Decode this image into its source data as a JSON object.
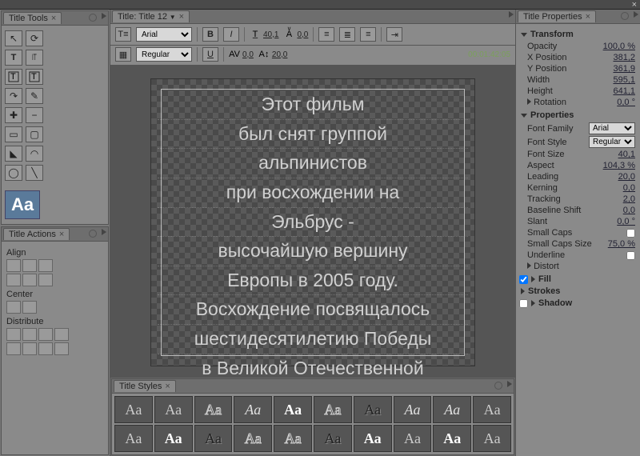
{
  "panels": {
    "tools": "Title Tools",
    "actions": "Title Actions",
    "titler": "Title: Title 12",
    "styles": "Title Styles",
    "properties": "Title Properties"
  },
  "toolbar": {
    "font": "Arial",
    "fontStyle": "Regular",
    "fontSize": "40,1",
    "leading": "20,0",
    "kerning": "0,0",
    "timecode": "00:01:42:05"
  },
  "titleText": {
    "l1": "Этот фильм",
    "l2": "был снят группой",
    "l3": "альпинистов",
    "l4": "при восхождении на",
    "l5": "Эльбрус -",
    "l6": "высочайшую вершину",
    "l7": "Европы в 2005 году.",
    "l8": "Восхождение посвящалось",
    "l9": "шестидесятилетию Победы",
    "l10": "в Великой Отечественной"
  },
  "actions": {
    "align": "Align",
    "center": "Center",
    "distribute": "Distribute"
  },
  "props": {
    "transform": "Transform",
    "opacity_l": "Opacity",
    "opacity_v": "100,0 %",
    "xpos_l": "X Position",
    "xpos_v": "381,2",
    "ypos_l": "Y Position",
    "ypos_v": "361,9",
    "width_l": "Width",
    "width_v": "595,1",
    "height_l": "Height",
    "height_v": "641,1",
    "rotation_l": "Rotation",
    "rotation_v": "0,0 °",
    "properties": "Properties",
    "fontfam_l": "Font Family",
    "fontfam_v": "Arial",
    "fontstyle_l": "Font Style",
    "fontstyle_v": "Regular",
    "fontsize_l": "Font Size",
    "fontsize_v": "40,1",
    "aspect_l": "Aspect",
    "aspect_v": "104,3 %",
    "leading_l": "Leading",
    "leading_v": "20,0",
    "kerning_l": "Kerning",
    "kerning_v": "0,0",
    "tracking_l": "Tracking",
    "tracking_v": "2,0",
    "baseline_l": "Baseline Shift",
    "baseline_v": "0,0",
    "slant_l": "Slant",
    "slant_v": "0,0 °",
    "smallcaps_l": "Small Caps",
    "smallcapssize_l": "Small Caps Size",
    "smallcapssize_v": "75,0 %",
    "underline_l": "Underline",
    "distort_l": "Distort",
    "fill": "Fill",
    "strokes": "Strokes",
    "shadow": "Shadow"
  },
  "styleSample": "Aa"
}
